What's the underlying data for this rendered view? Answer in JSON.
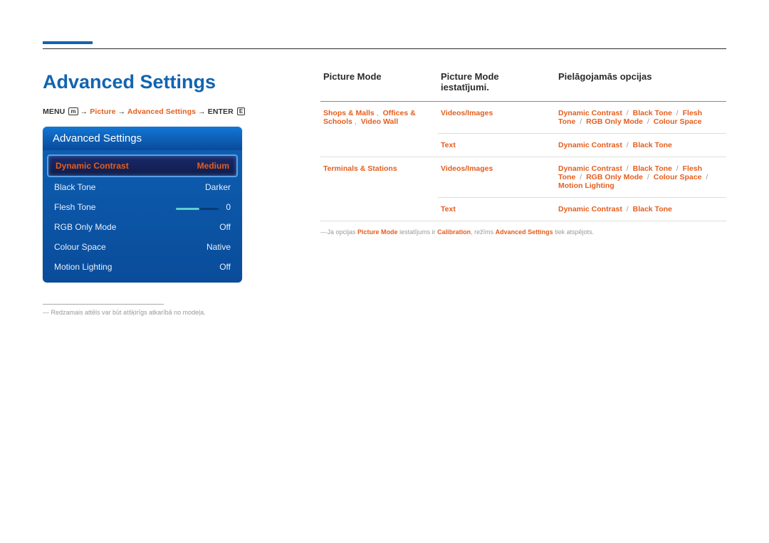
{
  "title": "Advanced Settings",
  "menu_path": {
    "menu": "MENU",
    "menu_icon": "m",
    "arrow": "→",
    "picture": "Picture",
    "advanced": "Advanced Settings",
    "enter": "ENTER",
    "enter_icon": "E"
  },
  "osd": {
    "header": "Advanced Settings",
    "items": [
      {
        "label": "Dynamic Contrast",
        "value": "Medium",
        "selected": true
      },
      {
        "label": "Black Tone",
        "value": "Darker"
      },
      {
        "label": "Flesh Tone",
        "value": "0",
        "slider": true
      },
      {
        "label": "RGB Only Mode",
        "value": "Off"
      },
      {
        "label": "Colour Space",
        "value": "Native"
      },
      {
        "label": "Motion Lighting",
        "value": "Off"
      }
    ]
  },
  "disclaimer": "Redzamais attēls var būt atšķirīgs atkarībā no modeļa.",
  "table": {
    "headers": {
      "col1": "Picture Mode",
      "col2": "Picture Mode iestatījumi.",
      "col3": "Pielāgojamās opcijas"
    },
    "rows": [
      {
        "c1": [
          "Shops & Malls",
          "Offices & Schools",
          "Video Wall"
        ],
        "c1_sep": ", ",
        "c2": "Videos/Images",
        "c3": [
          "Dynamic Contrast",
          "Black Tone",
          "Flesh Tone",
          "RGB Only Mode",
          "Colour Space"
        ]
      },
      {
        "c1": [],
        "c2": "Text",
        "c3": [
          "Dynamic Contrast",
          "Black Tone"
        ]
      },
      {
        "c1": [
          "Terminals & Stations"
        ],
        "c2": "Videos/Images",
        "c3": [
          "Dynamic Contrast",
          "Black Tone",
          "Flesh Tone",
          "RGB Only Mode",
          "Colour Space",
          "Motion Lighting"
        ]
      },
      {
        "c1": [],
        "c2": "Text",
        "c3": [
          "Dynamic Contrast",
          "Black Tone"
        ]
      }
    ]
  },
  "note": {
    "a": "Ja opcijas ",
    "b": "Picture Mode",
    "c": " iestatījums ir ",
    "d": "Calibration",
    "e": ", režīms ",
    "f": "Advanced Settings",
    "g": " tiek atspējots."
  }
}
